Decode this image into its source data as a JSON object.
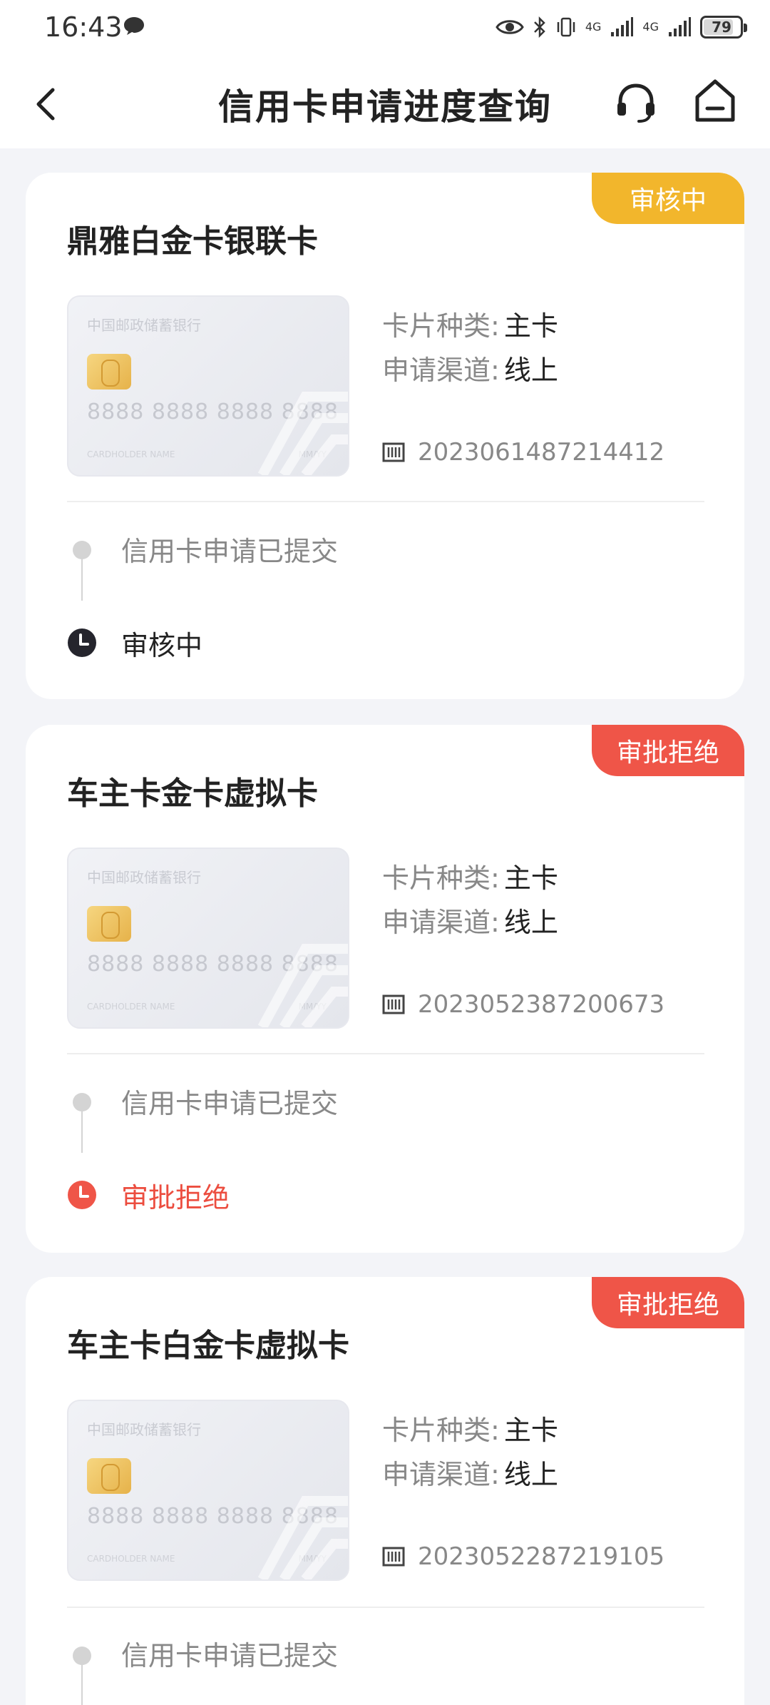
{
  "status_bar": {
    "time": "16:43",
    "signal1": "4G",
    "signal2": "4G",
    "battery": "79",
    "battery_level": 0.79
  },
  "header": {
    "title": "信用卡申请进度查询"
  },
  "labels": {
    "card_type_label": "卡片种类:",
    "channel_label": "申请渠道:",
    "card_bank": "中国邮政储蓄银行",
    "card_number_mask": "8888 8888 8888 8888",
    "cardholder": "CARDHOLDER NAME",
    "expiry": "MM/YY"
  },
  "applications": [
    {
      "name": "鼎雅白金卡银联卡",
      "status_badge": "审核中",
      "card_type": "主卡",
      "channel": "线上",
      "application_no": "2023061487214412",
      "timeline": [
        {
          "text": "信用卡申请已提交"
        },
        {
          "text": "审核中"
        }
      ]
    },
    {
      "name": "车主卡金卡虚拟卡",
      "status_badge": "审批拒绝",
      "card_type": "主卡",
      "channel": "线上",
      "application_no": "2023052387200673",
      "timeline": [
        {
          "text": "信用卡申请已提交"
        },
        {
          "text": "审批拒绝"
        }
      ]
    },
    {
      "name": "车主卡白金卡虚拟卡",
      "status_badge": "审批拒绝",
      "card_type": "主卡",
      "channel": "线上",
      "application_no": "2023052287219105",
      "timeline": [
        {
          "text": "信用卡申请已提交"
        }
      ]
    }
  ],
  "colors": {
    "review_badge": "#f2b62c",
    "reject_badge": "#ef5548",
    "reject_text": "#ec4d3f",
    "background": "#f3f4f8"
  }
}
